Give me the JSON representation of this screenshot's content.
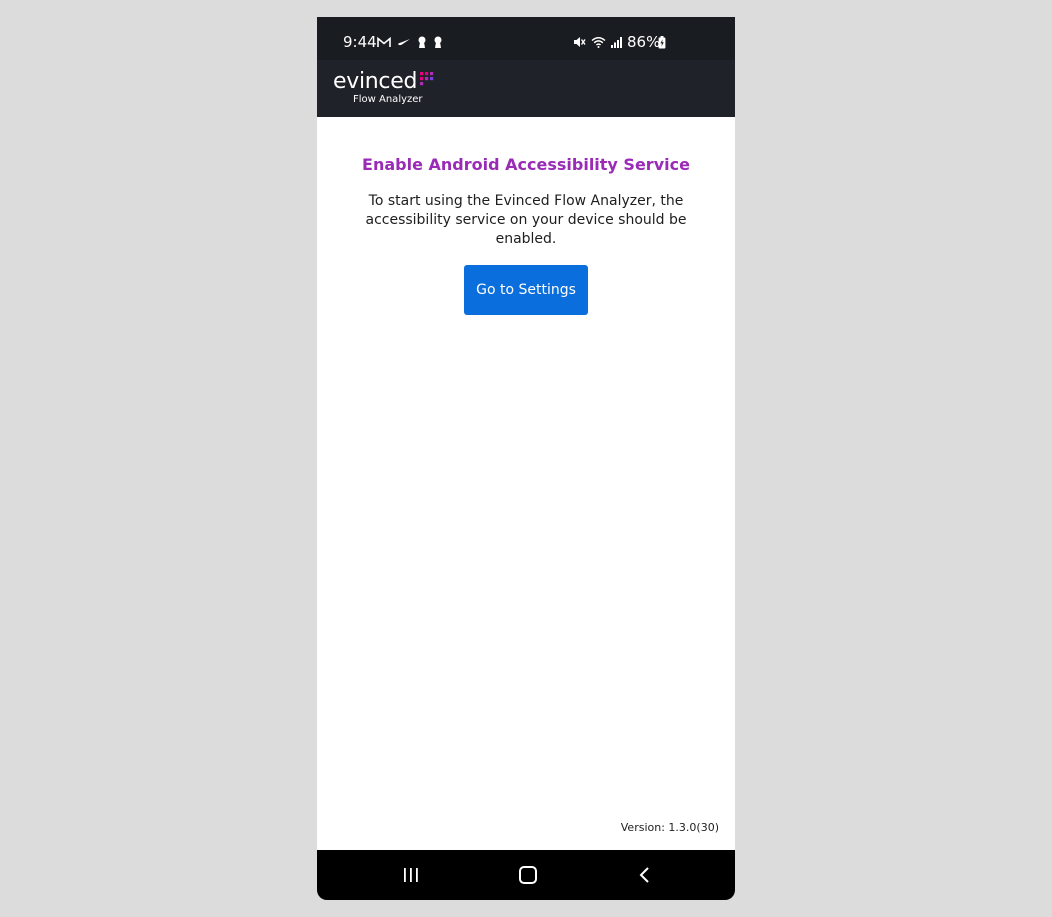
{
  "status_bar": {
    "time": "9:44",
    "battery": "86%",
    "left_icons": [
      "gmail-icon",
      "nike-icon",
      "keyhole-icon",
      "keyhole-icon"
    ],
    "right_icons": [
      "mute-icon",
      "wifi-icon",
      "signal-icon",
      "battery-charging-icon"
    ]
  },
  "app_bar": {
    "logo_text": "evinced",
    "logo_subtitle": "Flow Analyzer",
    "logo_dot_colors": [
      "#e6007e",
      "#b12ab8",
      "#7b3fe4"
    ]
  },
  "main": {
    "title": "Enable Android Accessibility Service",
    "description": "To start using the Evinced Flow Analyzer, the accessibility service on your device should be enabled.",
    "button_label": "Go to Settings",
    "version": "Version: 1.3.0(30)"
  },
  "nav_bar": {
    "buttons": [
      "recent-apps-icon",
      "home-icon",
      "back-icon"
    ]
  },
  "colors": {
    "title": "#9a2bb6",
    "button": "#0a6fdc",
    "app_bar": "#1f2228",
    "status_bar": "#191c20"
  }
}
